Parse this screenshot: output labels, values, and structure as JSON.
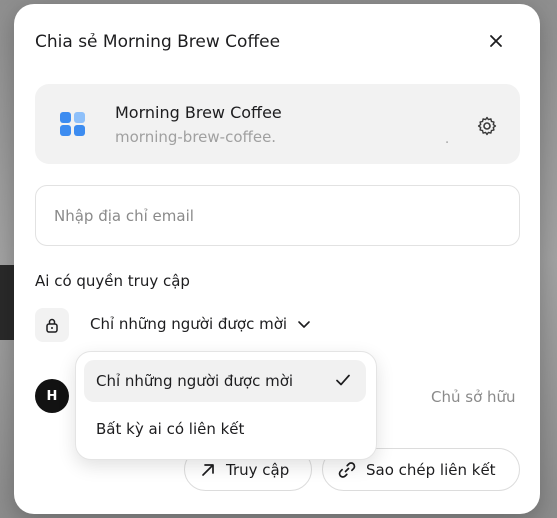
{
  "dialog": {
    "title": "Chia sẻ Morning Brew Coffee"
  },
  "app": {
    "name": "Morning Brew Coffee",
    "url": "morning-brew-coffee.",
    "url_tail": ".",
    "icon": "app-grid-icon",
    "accent": "#3d8cf0"
  },
  "email": {
    "placeholder": "Nhập địa chỉ email",
    "value": ""
  },
  "access": {
    "heading": "Ai có quyền truy cập",
    "selected": "Chỉ những người được mời"
  },
  "owner": {
    "avatar_initial": "H",
    "role": "Chủ sở hữu"
  },
  "menu": {
    "items": [
      {
        "label": "Chỉ những người được mời",
        "selected": true
      },
      {
        "label": "Bất kỳ ai có liên kết",
        "selected": false
      }
    ]
  },
  "actions": {
    "access_label": "Truy cập",
    "copy_label": "Sao chép liên kết"
  }
}
